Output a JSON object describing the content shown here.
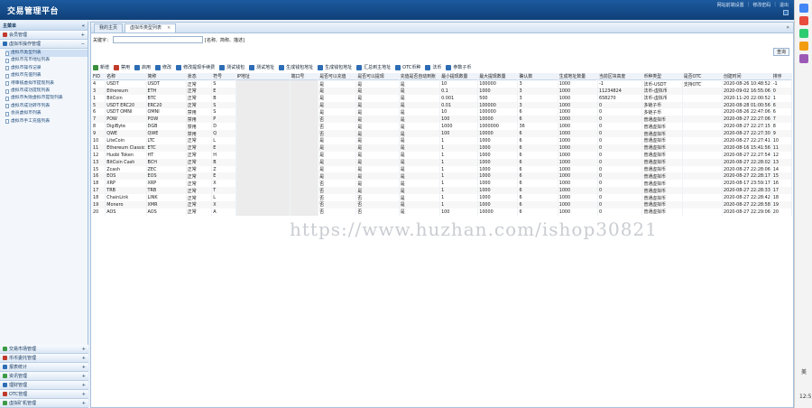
{
  "header": {
    "title": "交易管理平台",
    "links": [
      "网站前端设置",
      "修改密码",
      "退出"
    ]
  },
  "sidebar": {
    "title": "主菜单",
    "collapse_icon": "«",
    "groups": [
      {
        "label": "会员管理",
        "icon": "+"
      },
      {
        "label": "虚拟币操作管理",
        "icon": "−",
        "expanded": true,
        "items": [
          "虚拟币类型列表",
          "虚拟币充币地址列表",
          "虚拟币操作记录",
          "虚拟币充值列表",
          "待审核虚拟币提现列表",
          "虚拟币成功提现列表",
          "虚拟币失败虚拟币提现列表",
          "虚拟币成功转币列表",
          "会员虚拟币列表",
          "虚拟币手工充值列表"
        ]
      }
    ],
    "bottom_groups": [
      {
        "label": "交易市场管理",
        "icon": "+"
      },
      {
        "label": "币币委托管理",
        "icon": "+"
      },
      {
        "label": "报表统计",
        "icon": "+"
      },
      {
        "label": "资讯管理",
        "icon": "+"
      },
      {
        "label": "理财管理",
        "icon": "+"
      },
      {
        "label": "OTC管理",
        "icon": "+"
      },
      {
        "label": "虚拟矿机管理",
        "icon": "+"
      }
    ]
  },
  "tabs": [
    {
      "label": "我的主页"
    },
    {
      "label": "虚拟币类型列表",
      "close": "×"
    }
  ],
  "tabs_scroll": "»",
  "search": {
    "label": "关键字：",
    "value": "",
    "hint": "[名称、简称、描述]",
    "button": "查询"
  },
  "toolbar": [
    {
      "label": "新增",
      "color": "#3a8f3a"
    },
    {
      "label": "禁用",
      "color": "#c0392b"
    },
    {
      "label": "启用",
      "color": "#2d6db5"
    },
    {
      "label": "修改",
      "color": "#2d6db5"
    },
    {
      "label": "修改提现手续费",
      "color": "#2d6db5"
    },
    {
      "label": "测试钱包",
      "color": "#2d6db5"
    },
    {
      "label": "测试地址",
      "color": "#2d6db5"
    },
    {
      "label": "生成钱包地址",
      "color": "#2d6db5"
    },
    {
      "label": "生成钱包地址",
      "color": "#2d6db5"
    },
    {
      "label": "汇总到主地址",
      "color": "#2d6db5"
    },
    {
      "label": "OTC币种",
      "color": "#2d6db5"
    },
    {
      "label": "法币",
      "color": "#2d6db5"
    },
    {
      "label": "参数子币",
      "color": "#2d6db5"
    }
  ],
  "table": {
    "columns": [
      "FID",
      "名称",
      "简称",
      "状态",
      "符号",
      "IP地址",
      "端口号",
      "是否可以充值",
      "是否可以提现",
      "充值是否自动到账",
      "最小提现数量",
      "最大提现数量",
      "确认数",
      "生成地址数量",
      "当前区块高度",
      "币种类型",
      "是否OTC",
      "创建时间",
      "排序"
    ],
    "rows": [
      [
        "4",
        "USDT",
        "USDT",
        "正常",
        "S",
        "",
        "",
        "是",
        "是",
        "是",
        "10",
        "100000",
        "3",
        "1000",
        "-1",
        "法币-USDT",
        "支持OTC",
        "2020-08-26 10:48:52",
        "-1"
      ],
      [
        "3",
        "Ethereum",
        "ETH",
        "正常",
        "E",
        "",
        "",
        "是",
        "是",
        "是",
        "0.1",
        "1000",
        "3",
        "1000",
        "11234824",
        "法币-虚拟币",
        "",
        "2020-09-02 16:55:06",
        "0"
      ],
      [
        "1",
        "BitCoin",
        "BTC",
        "正常",
        "B",
        "",
        "",
        "是",
        "是",
        "是",
        "0.001",
        "500",
        "3",
        "1000",
        "658270",
        "法币-虚拟币",
        "",
        "2020-11-20 22:00:52",
        "1"
      ],
      [
        "5",
        "USDT ERC20",
        "ERC20",
        "正常",
        "S",
        "",
        "",
        "是",
        "是",
        "是",
        "0.01",
        "100000",
        "3",
        "1000",
        "0",
        "多链子币",
        "",
        "2020-08-28 01:00:56",
        "6"
      ],
      [
        "6",
        "USDT OMNI",
        "OMNI",
        "禁用",
        "S",
        "",
        "",
        "是",
        "是",
        "是",
        "10",
        "100000",
        "6",
        "1000",
        "0",
        "多链子币",
        "",
        "2020-08-26 22:47:06",
        "6"
      ],
      [
        "7",
        "POW",
        "POW",
        "禁用",
        "P",
        "",
        "",
        "否",
        "是",
        "是",
        "100",
        "10000",
        "6",
        "1000",
        "0",
        "普通虚拟币",
        "",
        "2020-08-27 22:27:06",
        "7"
      ],
      [
        "8",
        "DigiByte",
        "DGB",
        "禁用",
        "D",
        "",
        "",
        "否",
        "是",
        "是",
        "1000",
        "1000000",
        "36",
        "1000",
        "0",
        "普通虚拟币",
        "",
        "2020-08-27 22:27:15",
        "8"
      ],
      [
        "9",
        "QWE",
        "QWE",
        "禁用",
        "Q",
        "",
        "",
        "否",
        "是",
        "是",
        "100",
        "10000",
        "6",
        "1000",
        "0",
        "普通虚拟币",
        "",
        "2020-08-27 22:27:30",
        "9"
      ],
      [
        "10",
        "LiteCoin",
        "LTC",
        "正常",
        "L",
        "",
        "",
        "是",
        "是",
        "是",
        "1",
        "1000",
        "6",
        "1000",
        "0",
        "普通虚拟币",
        "",
        "2020-08-27 22:27:41",
        "10"
      ],
      [
        "11",
        "Ethereum Classic",
        "ETC",
        "正常",
        "E",
        "",
        "",
        "是",
        "是",
        "是",
        "1",
        "1000",
        "6",
        "1000",
        "0",
        "普通虚拟币",
        "",
        "2020-08-16 15:41:56",
        "11"
      ],
      [
        "12",
        "Huobi Token",
        "HT",
        "正常",
        "H",
        "",
        "",
        "是",
        "是",
        "是",
        "1",
        "1000",
        "6",
        "1000",
        "0",
        "普通虚拟币",
        "",
        "2020-08-27 22:27:54",
        "12"
      ],
      [
        "13",
        "BitCoin Cash",
        "BCH",
        "正常",
        "B",
        "",
        "",
        "是",
        "是",
        "是",
        "1",
        "1000",
        "6",
        "1000",
        "0",
        "普通虚拟币",
        "",
        "2020-08-27 22:28:02",
        "13"
      ],
      [
        "15",
        "Zcash",
        "ZEC",
        "正常",
        "Z",
        "",
        "",
        "是",
        "是",
        "是",
        "1",
        "1000",
        "6",
        "1000",
        "0",
        "普通虚拟币",
        "",
        "2020-08-27 22:28:06",
        "14"
      ],
      [
        "16",
        "EOS",
        "EOS",
        "正常",
        "E",
        "",
        "",
        "是",
        "是",
        "是",
        "1",
        "1000",
        "6",
        "1000",
        "0",
        "普通虚拟币",
        "",
        "2020-08-27 22:28:17",
        "15"
      ],
      [
        "18",
        "XRP",
        "XRP",
        "正常",
        "X",
        "",
        "",
        "否",
        "是",
        "是",
        "1",
        "1000",
        "6",
        "1000",
        "0",
        "普通虚拟币",
        "",
        "2020-08-17 23:59:17",
        "16"
      ],
      [
        "17",
        "TRB",
        "TRB",
        "正常",
        "T",
        "",
        "",
        "否",
        "是",
        "是",
        "1",
        "1000",
        "6",
        "1000",
        "0",
        "普通虚拟币",
        "",
        "2020-08-27 22:28:33",
        "17"
      ],
      [
        "18",
        "ChainLink",
        "LINK",
        "正常",
        "L",
        "",
        "",
        "否",
        "否",
        "是",
        "1",
        "1000",
        "6",
        "1000",
        "0",
        "普通虚拟币",
        "",
        "2020-08-27 22:28:42",
        "18"
      ],
      [
        "19",
        "Monero",
        "XMR",
        "正常",
        "X",
        "",
        "",
        "否",
        "否",
        "是",
        "1",
        "1000",
        "6",
        "1000",
        "0",
        "普通虚拟币",
        "",
        "2020-08-27 22:28:58",
        "19"
      ],
      [
        "20",
        "AOS",
        "AOS",
        "正常",
        "A",
        "",
        "",
        "否",
        "否",
        "是",
        "100",
        "10000",
        "6",
        "1000",
        "0",
        "普通虚拟币",
        "",
        "2020-08-27 22:29:06",
        "20"
      ]
    ]
  },
  "watermark": "https://www.huzhan.com/ishop30821",
  "right_bar": {
    "labels": [
      "美",
      "12:5"
    ]
  }
}
